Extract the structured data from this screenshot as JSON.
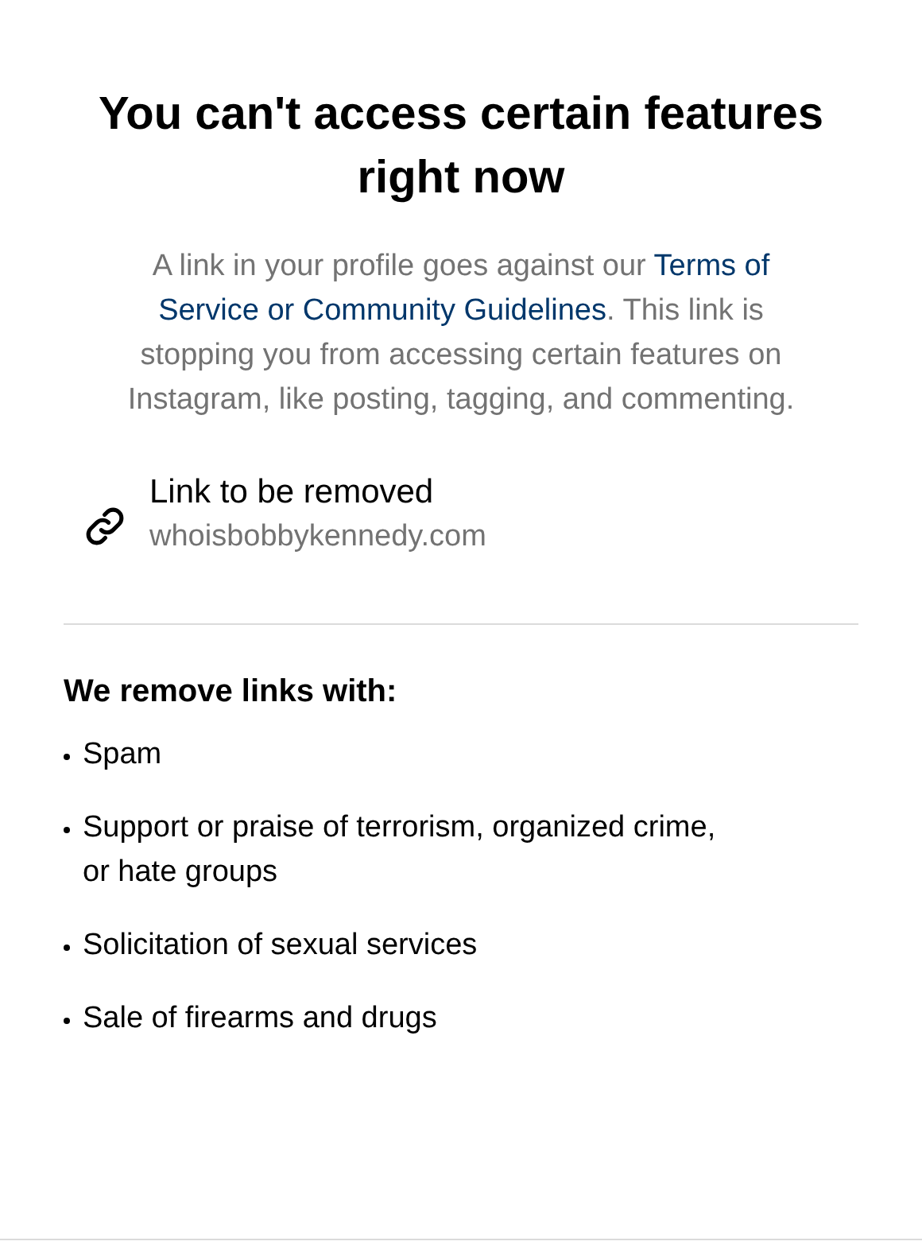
{
  "title": "You can't access certain features right now",
  "description": {
    "before": "A link in your profile goes against our ",
    "link": [
      "Terms of",
      "Service or Community Guidelines"
    ],
    "after": ". This link is stopping you from accessing certain features on Instagram, like posting, tagging, and commenting."
  },
  "removed_link": {
    "label": "Link to be removed",
    "url": "whoisbobbykennedy.com"
  },
  "reasons": {
    "heading": "We remove links with:",
    "items": [
      "Spam",
      "Support or praise of terrorism, organized crime, or hate groups",
      "Solicitation of sexual services",
      "Sale of firearms and drugs"
    ]
  }
}
